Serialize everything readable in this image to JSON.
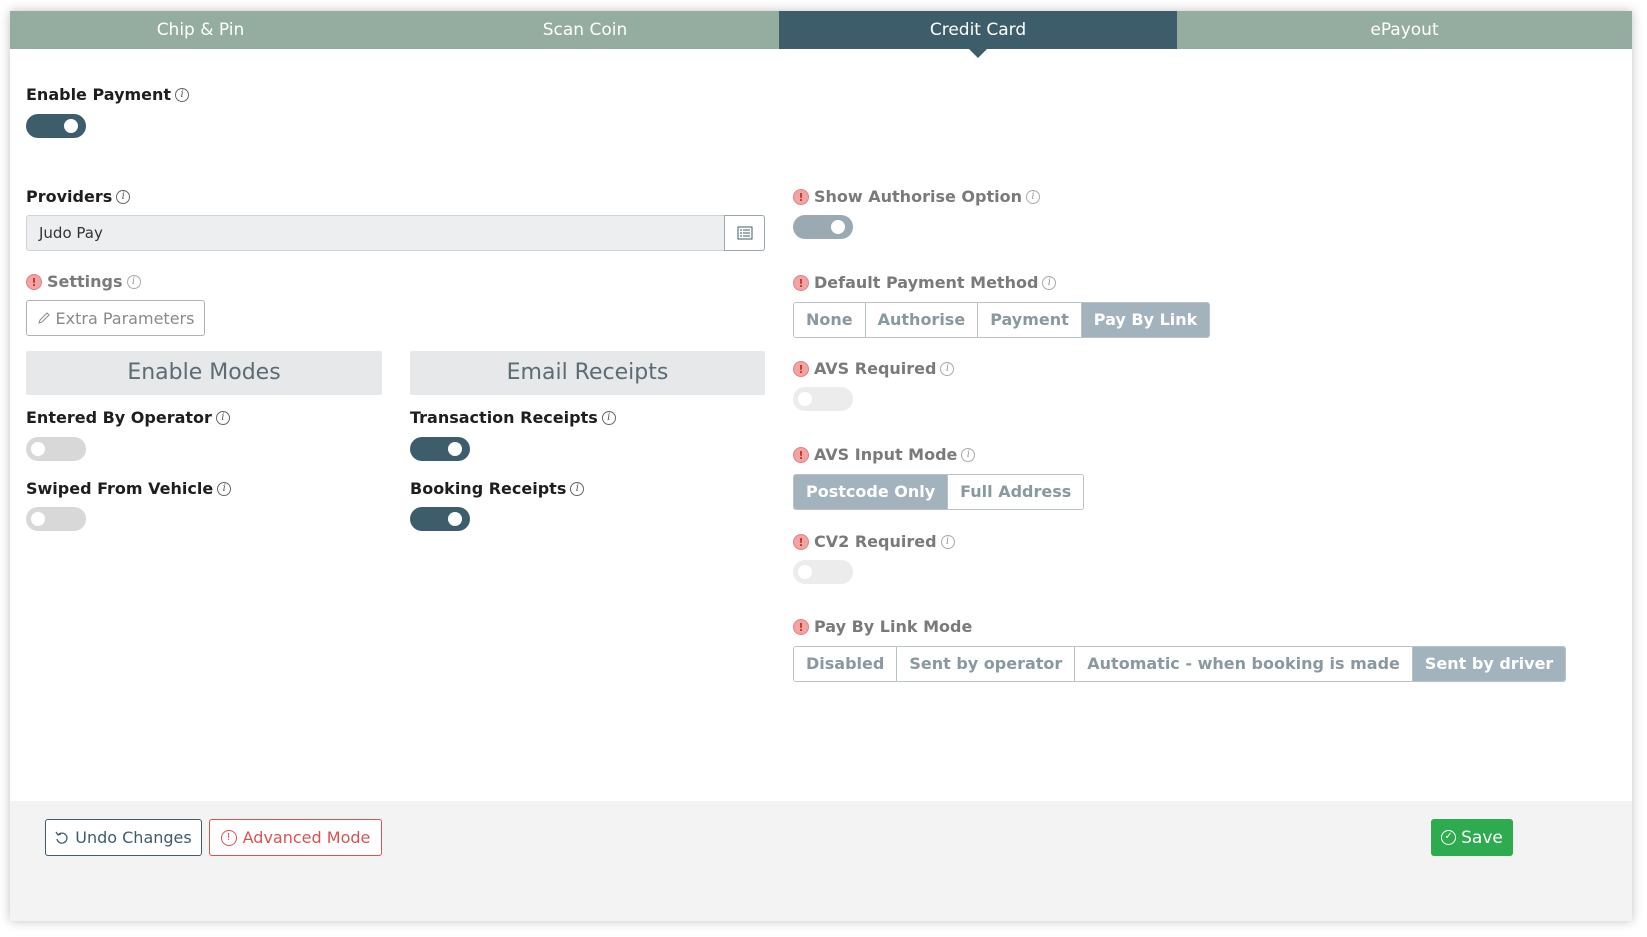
{
  "tabs": [
    {
      "label": "Chip & Pin",
      "active": false
    },
    {
      "label": "Scan Coin",
      "active": false
    },
    {
      "label": "Credit Card",
      "active": true
    },
    {
      "label": "ePayout",
      "active": false
    }
  ],
  "enable_payment": {
    "label": "Enable Payment",
    "enabled": true
  },
  "providers": {
    "label": "Providers",
    "value": "Judo Pay",
    "picker_icon": "list-icon"
  },
  "settings": {
    "label": "Settings",
    "extra_params_label": "Extra Parameters",
    "icon": "pencil-icon"
  },
  "enable_modes": {
    "title": "Enable Modes",
    "entered_by_operator": {
      "label": "Entered By Operator",
      "enabled": false
    },
    "swiped_from_vehicle": {
      "label": "Swiped From Vehicle",
      "enabled": false
    }
  },
  "email_receipts": {
    "title": "Email Receipts",
    "transaction_receipts": {
      "label": "Transaction Receipts",
      "enabled": true
    },
    "booking_receipts": {
      "label": "Booking Receipts",
      "enabled": true
    }
  },
  "advanced": {
    "show_authorise_option": {
      "label": "Show Authorise Option",
      "enabled": true
    },
    "default_payment_method": {
      "label": "Default Payment Method",
      "options": [
        "None",
        "Authorise",
        "Payment",
        "Pay By Link"
      ],
      "selected": "Pay By Link"
    },
    "avs_required": {
      "label": "AVS Required",
      "enabled": false
    },
    "avs_input_mode": {
      "label": "AVS Input Mode",
      "options": [
        "Postcode Only",
        "Full Address"
      ],
      "selected": "Postcode Only"
    },
    "cv2_required": {
      "label": "CV2 Required",
      "enabled": false
    },
    "pay_by_link_mode": {
      "label": "Pay By Link Mode",
      "options": [
        "Disabled",
        "Sent by operator",
        "Automatic - when booking is made",
        "Sent by driver"
      ],
      "selected": "Sent by driver"
    }
  },
  "footer": {
    "undo_label": "Undo Changes",
    "advanced_label": "Advanced Mode",
    "save_label": "Save"
  },
  "colors": {
    "accent": "#3e5d6b",
    "tab_bg": "#95ada1",
    "save": "#2eaa4f",
    "danger": "#d9534f"
  }
}
